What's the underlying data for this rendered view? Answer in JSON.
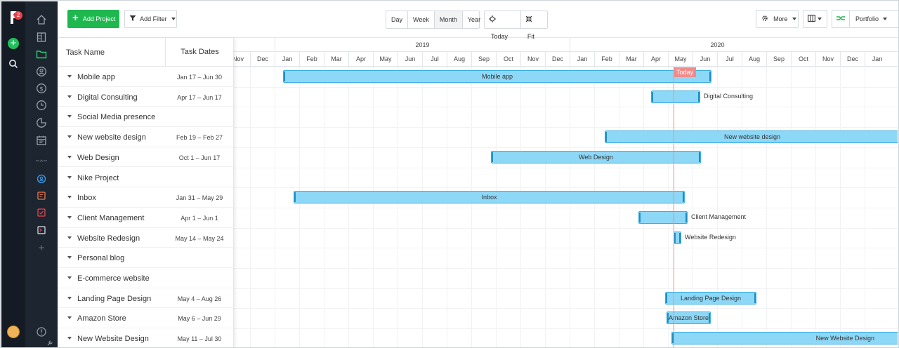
{
  "app": {
    "notification_count": "2"
  },
  "toolbar": {
    "add_project": "Add Project",
    "add_filter": "Add Filter",
    "views": [
      "Day",
      "Week",
      "Month",
      "Year"
    ],
    "active_view": "Month",
    "today": "Today",
    "fit": "Fit",
    "more": "More",
    "portfolio": "Portfolio"
  },
  "task_list": {
    "col_name": "Task Name",
    "col_dates": "Task Dates",
    "tasks": [
      {
        "name": "Mobile app",
        "dates": "Jan 17 – Jun 30"
      },
      {
        "name": "Digital Consulting",
        "dates": "Apr 17 – Jun 17"
      },
      {
        "name": "Social Media presence",
        "dates": ""
      },
      {
        "name": "New website design",
        "dates": "Feb 19 – Feb 27"
      },
      {
        "name": "Web Design",
        "dates": "Oct 1 – Jun 17"
      },
      {
        "name": "Nike Project",
        "dates": ""
      },
      {
        "name": "Inbox",
        "dates": "Jan 31 – May 29"
      },
      {
        "name": "Client Management",
        "dates": "Apr 1 – Jun 1"
      },
      {
        "name": "Website Redesign",
        "dates": "May 14 – May 24"
      },
      {
        "name": "Personal blog",
        "dates": ""
      },
      {
        "name": "E-commerce website",
        "dates": ""
      },
      {
        "name": "Landing Page Design",
        "dates": "May 4 – Aug 26"
      },
      {
        "name": "Amazon Store",
        "dates": "May 6 – Jun 29"
      },
      {
        "name": "New Website Design",
        "dates": "May 11 – Jul 30"
      }
    ]
  },
  "timeline": {
    "years": [
      "2019",
      "2020"
    ],
    "months": [
      "Nov",
      "Dec",
      "Jan",
      "Feb",
      "Mar",
      "Apr",
      "May",
      "Jun",
      "Jul",
      "Aug",
      "Sep",
      "Oct",
      "Nov",
      "Dec",
      "Jan",
      "Feb",
      "Mar",
      "Apr",
      "May",
      "Jun",
      "Jul",
      "Aug",
      "Sep",
      "Oct",
      "Nov",
      "Dec",
      "Jan"
    ],
    "today_label": "Today"
  },
  "bars": [
    {
      "row": 0,
      "label": "Mobile app",
      "label_outside": false
    },
    {
      "row": 1,
      "label": "Digital Consulting",
      "label_outside": true
    },
    {
      "row": 3,
      "label": "New website design",
      "label_outside": false
    },
    {
      "row": 4,
      "label": "Web Design",
      "label_outside": false
    },
    {
      "row": 6,
      "label": "Inbox",
      "label_outside": false
    },
    {
      "row": 7,
      "label": "Client Management",
      "label_outside": true
    },
    {
      "row": 8,
      "label": "Website Redesign",
      "label_outside": true
    },
    {
      "row": 11,
      "label": "Landing Page Design",
      "label_outside": false
    },
    {
      "row": 12,
      "label": "Amazon Store",
      "label_outside": false
    },
    {
      "row": 13,
      "label": "New Website Design",
      "label_outside": false
    }
  ]
}
